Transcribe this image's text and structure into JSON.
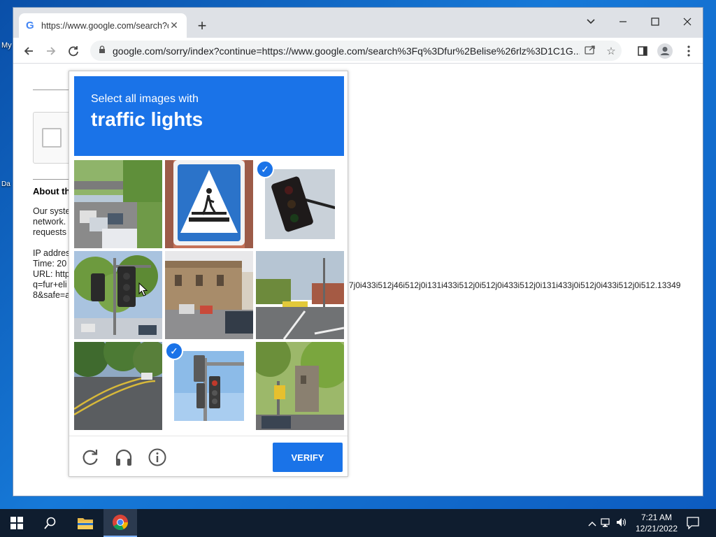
{
  "desktop": {
    "icon_labels": [
      "My",
      "Da"
    ]
  },
  "browser": {
    "tab": {
      "title": "https://www.google.com/search?q=fur+elise",
      "favicon": "google-g-icon"
    },
    "window_controls": [
      "chevron-down-icon",
      "minimize-icon",
      "maximize-icon",
      "close-icon"
    ],
    "url": "google.com/sorry/index?continue=https://www.google.com/search%3Fq%3Dfur%2Belise%26rlz%3D1C1G..."
  },
  "page": {
    "about_heading": "About th",
    "system_lines": [
      "Our syste",
      "network.",
      "requests"
    ],
    "info_lines": [
      "IP addres",
      "Time: 20",
      "URL: http",
      "q=fur+eli",
      "8&safe=a"
    ],
    "long_url_fragment": "7j0i433i512j46i512j0i131i433i512j0i512j0i433i512j0i131i433j0i512j0i433i512j0i512.13349"
  },
  "challenge": {
    "instruction": "Select all images with",
    "target": "traffic lights",
    "tiles": [
      {
        "index": 1,
        "content": "street-traffic",
        "selected": false
      },
      {
        "index": 2,
        "content": "crosswalk-sign",
        "selected": false
      },
      {
        "index": 3,
        "content": "traffic-light",
        "selected": true
      },
      {
        "index": 4,
        "content": "traffic-light-trees",
        "selected": false
      },
      {
        "index": 5,
        "content": "building-street",
        "selected": false
      },
      {
        "index": 6,
        "content": "road-bus",
        "selected": false
      },
      {
        "index": 7,
        "content": "road-trees",
        "selected": false
      },
      {
        "index": 8,
        "content": "traffic-light-sky",
        "selected": true
      },
      {
        "index": 9,
        "content": "yellow-sign-trees",
        "selected": false
      }
    ],
    "verify_label": "VERIFY",
    "footer_icons": [
      "reload-icon",
      "headphones-icon",
      "info-icon"
    ]
  },
  "taskbar": {
    "time": "7:21 AM",
    "date": "12/21/2022"
  },
  "colors": {
    "recaptcha_blue": "#1a73e8",
    "taskbar": "#0f1d2f",
    "desktop": "#1679d8"
  }
}
